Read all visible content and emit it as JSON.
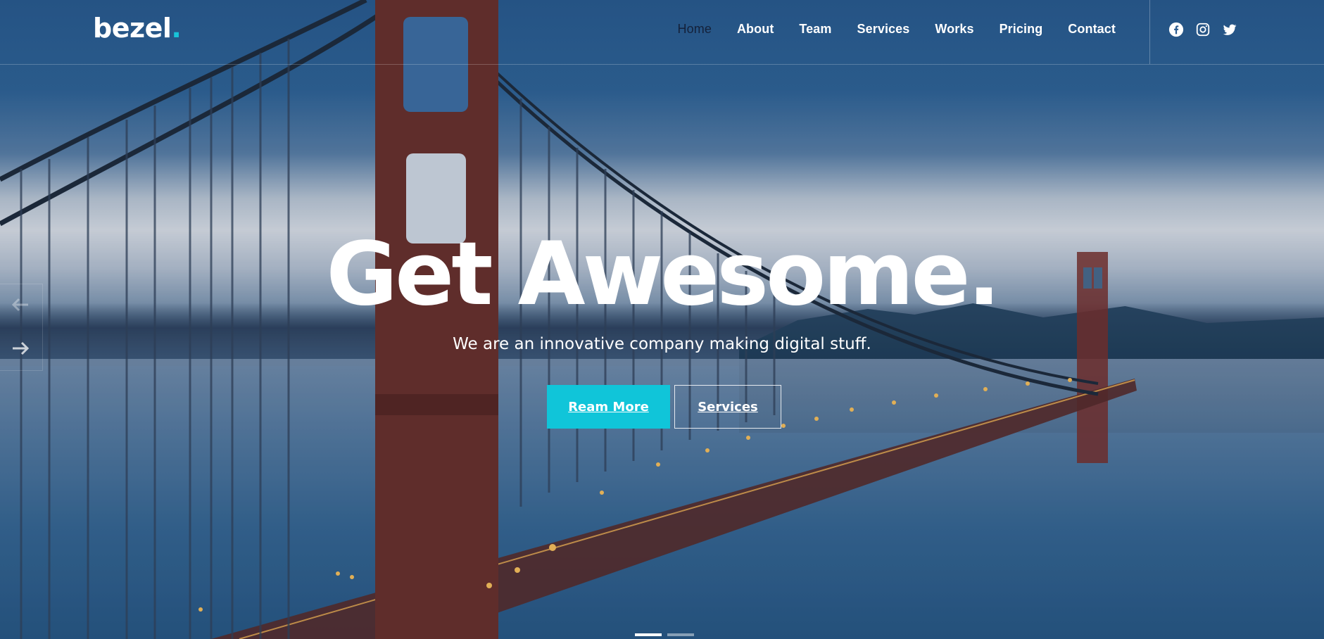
{
  "brand": {
    "name": "bezel",
    "dot": ".",
    "accent_color": "#10c5d9"
  },
  "nav": {
    "items": [
      {
        "label": "Home",
        "active": true
      },
      {
        "label": "About"
      },
      {
        "label": "Team"
      },
      {
        "label": "Services"
      },
      {
        "label": "Works"
      },
      {
        "label": "Pricing"
      },
      {
        "label": "Contact"
      }
    ],
    "socials": [
      "facebook-icon",
      "instagram-icon",
      "twitter-icon"
    ]
  },
  "hero": {
    "headline": "Get Awesome.",
    "subline": "We are an innovative company making digital stuff.",
    "primary_button": "Ream More",
    "secondary_button": "Services",
    "slides_count": 2,
    "active_slide": 1
  }
}
